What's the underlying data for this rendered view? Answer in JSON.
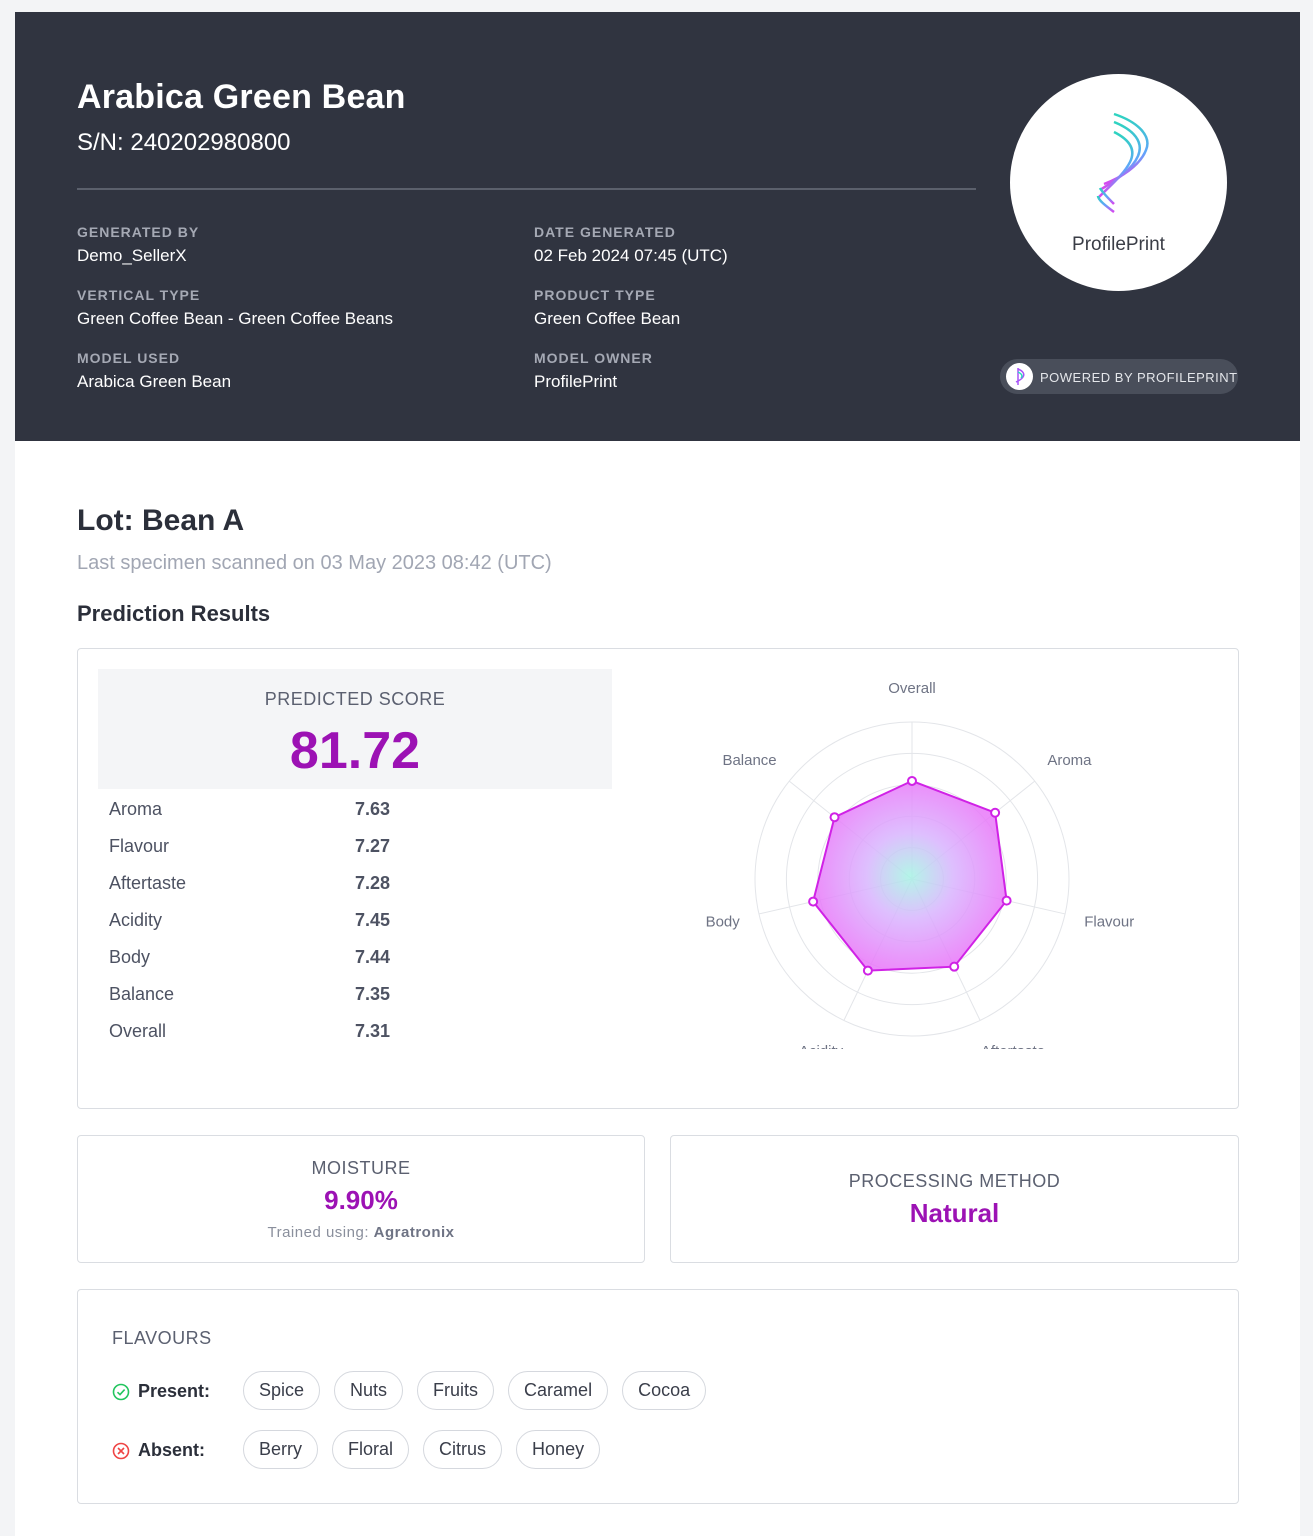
{
  "header": {
    "title": "Arabica Green Bean",
    "serial": "S/N: 240202980800",
    "meta": [
      {
        "label": "GENERATED BY",
        "value": "Demo_SellerX"
      },
      {
        "label": "DATE GENERATED",
        "value": "02 Feb 2024 07:45 (UTC)"
      },
      {
        "label": "VERTICAL TYPE",
        "value": "Green Coffee Bean - Green Coffee Beans"
      },
      {
        "label": "PRODUCT TYPE",
        "value": "Green Coffee Bean"
      },
      {
        "label": "MODEL USED",
        "value": "Arabica Green Bean"
      },
      {
        "label": "MODEL OWNER",
        "value": "ProfilePrint"
      }
    ],
    "logo_text": "ProfilePrint",
    "powered_by": "POWERED BY PROFILEPRINT"
  },
  "lot": {
    "title": "Lot: Bean A",
    "subtitle": "Last specimen scanned on 03 May 2023 08:42 (UTC)"
  },
  "prediction": {
    "section_title": "Prediction Results",
    "score_label": "PREDICTED SCORE",
    "score_value": "81.72",
    "attributes": [
      {
        "label": "Aroma",
        "value": "7.63"
      },
      {
        "label": "Flavour",
        "value": "7.27"
      },
      {
        "label": "Aftertaste",
        "value": "7.28"
      },
      {
        "label": "Acidity",
        "value": "7.45"
      },
      {
        "label": "Body",
        "value": "7.44"
      },
      {
        "label": "Balance",
        "value": "7.35"
      },
      {
        "label": "Overall",
        "value": "7.31"
      }
    ]
  },
  "chart_data": {
    "type": "radar",
    "axes": [
      "Overall",
      "Aroma",
      "Flavour",
      "Aftertaste",
      "Acidity",
      "Body",
      "Balance"
    ],
    "values": [
      7.31,
      7.63,
      7.27,
      7.28,
      7.45,
      7.44,
      7.35
    ],
    "rings": 5,
    "colors": {
      "fill": "#e879f9",
      "stroke": "#d022e6",
      "center": "#a7f3e4"
    }
  },
  "moisture": {
    "label": "MOISTURE",
    "value": "9.90%",
    "note_prefix": "Trained using:",
    "note_source": "Agratronix"
  },
  "processing": {
    "label": "PROCESSING METHOD",
    "value": "Natural"
  },
  "flavours": {
    "title": "FLAVOURS",
    "present_label": "Present:",
    "absent_label": "Absent:",
    "present": [
      "Spice",
      "Nuts",
      "Fruits",
      "Caramel",
      "Cocoa"
    ],
    "absent": [
      "Berry",
      "Floral",
      "Citrus",
      "Honey"
    ]
  },
  "colors": {
    "accent": "#9c12b4",
    "header_bg": "#303440"
  }
}
